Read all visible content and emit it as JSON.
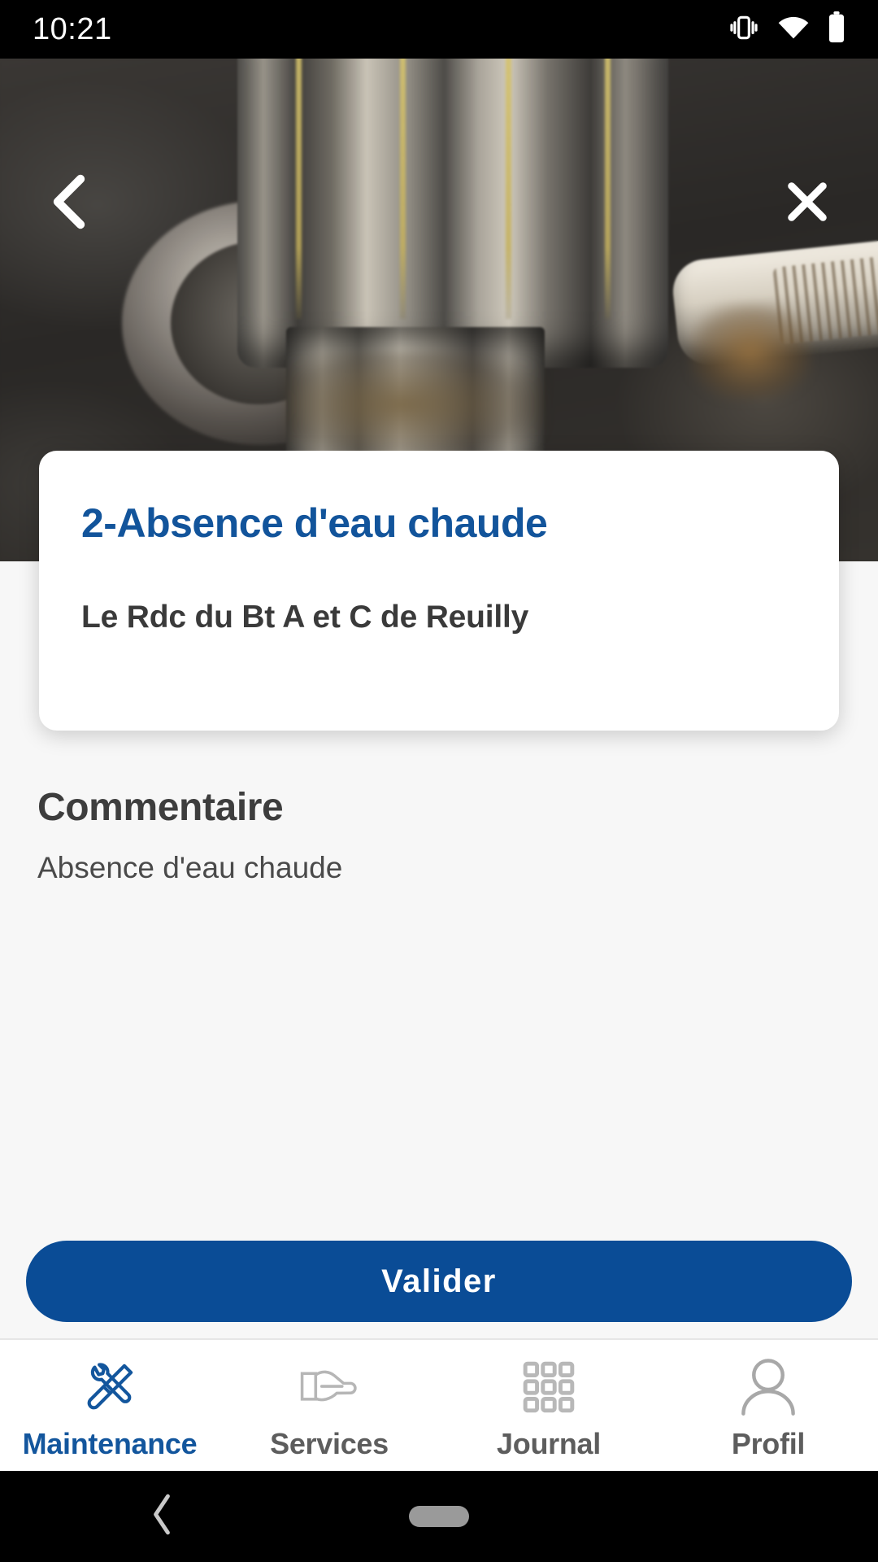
{
  "status_bar": {
    "time": "10:21",
    "icons": [
      "vibrate-icon",
      "wifi-icon",
      "battery-icon"
    ]
  },
  "hero": {
    "back_icon": "chevron-left-icon",
    "close_icon": "close-icon",
    "photo_alt": "plumbing-valve-photo",
    "carousel": {
      "total": 2,
      "active_index": 0,
      "active_color": "#1a6fe0",
      "inactive_color": "#ffffff"
    }
  },
  "info_card": {
    "title": "2-Absence d'eau chaude",
    "subtitle": "Le Rdc du Bt A et C de Reuilly",
    "title_color": "#12549b",
    "subtitle_color": "#3a3a3a"
  },
  "comment": {
    "heading": "Commentaire",
    "text": "Absence d'eau chaude"
  },
  "actions": {
    "validate_label": "Valider",
    "validate_color": "#0a4c96"
  },
  "bottom_nav": {
    "active_color": "#13569d",
    "inactive_color": "#5d5d5d",
    "items": [
      {
        "label": "Maintenance",
        "icon": "tools-icon",
        "active": true
      },
      {
        "label": "Services",
        "icon": "hand-icon",
        "active": false
      },
      {
        "label": "Journal",
        "icon": "grid-icon",
        "active": false
      },
      {
        "label": "Profil",
        "icon": "person-icon",
        "active": false
      }
    ]
  },
  "android_nav": {
    "back_icon": "chevron-left-icon",
    "home_icon": "home-pill-handle"
  }
}
